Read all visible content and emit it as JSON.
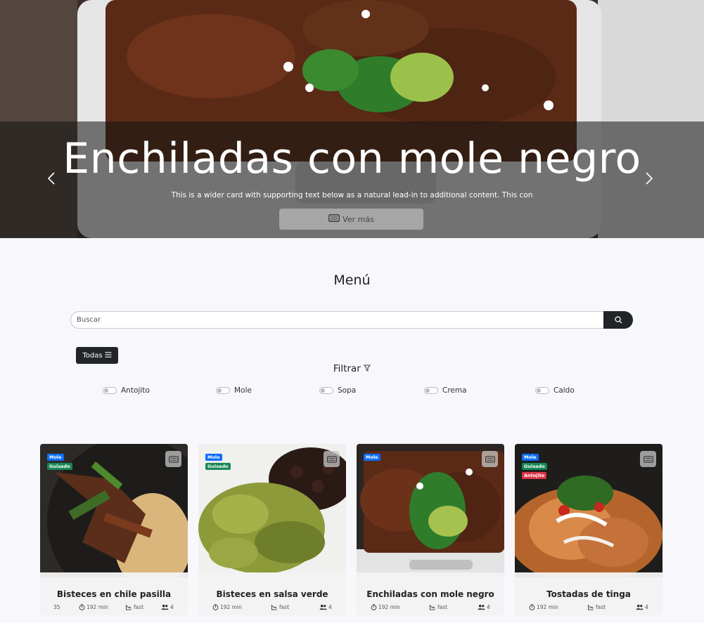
{
  "hero": {
    "title": "Enchiladas con mole negro",
    "text": "This is a wider card with supporting text below as a natural lead-in to additional content. This con",
    "button_label": "Ver más",
    "button_icon": "ticket-icon",
    "prev_icon": "chevron-left-icon",
    "next_icon": "chevron-right-icon"
  },
  "menu": {
    "title": "Menú",
    "search_placeholder": "Buscar",
    "search_icon": "search-icon",
    "all_button": "Todas",
    "filter_label": "Filtrar",
    "filters": [
      "Antojito",
      "Mole",
      "Sopa",
      "Crema",
      "Caldo"
    ]
  },
  "cards": [
    {
      "title": "Bisteces en chile pasilla",
      "badges": [
        "Mole",
        "Guisado"
      ],
      "number": "35",
      "time": "192 min",
      "speed": "fast",
      "servings": "4"
    },
    {
      "title": "Bisteces en salsa verde",
      "badges": [
        "Mole",
        "Guisado"
      ],
      "number": "",
      "time": "192 min",
      "speed": "fast",
      "servings": "4"
    },
    {
      "title": "Enchiladas con mole negro",
      "badges": [
        "Mole"
      ],
      "number": "",
      "time": "192 min",
      "speed": "fast",
      "servings": "4"
    },
    {
      "title": "Tostadas de tinga",
      "badges": [
        "Mole",
        "Guisado",
        "Antojito"
      ],
      "number": "",
      "time": "192 min",
      "speed": "fast",
      "servings": "4"
    }
  ],
  "colors": {
    "badge_mole": "#0d6efd",
    "badge_guisado": "#198754",
    "badge_antojito": "#dc3545",
    "dark": "#212529",
    "background": "#f7f7fc"
  }
}
